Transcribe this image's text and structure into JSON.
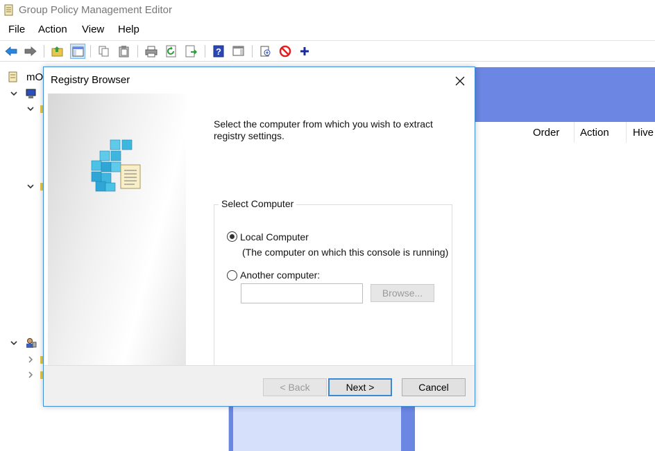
{
  "window": {
    "title": "Group Policy Management Editor"
  },
  "menu": [
    {
      "label": "File"
    },
    {
      "label": "Action"
    },
    {
      "label": "View"
    },
    {
      "label": "Help"
    }
  ],
  "toolbar": {
    "icons": [
      "back-arrow-icon",
      "forward-arrow-icon",
      "up-folder-icon",
      "show-hide-tree-icon",
      "copy-icon",
      "paste-icon",
      "print-icon",
      "refresh-icon",
      "export-list-icon",
      "help-icon",
      "show-hide-action-pane-icon",
      "new-item-icon",
      "delete-icon",
      "add-icon"
    ]
  },
  "tree": {
    "root_label": "mO"
  },
  "columns": [
    {
      "label": "Order"
    },
    {
      "label": "Action"
    },
    {
      "label": "Hive"
    }
  ],
  "dialog": {
    "title": "Registry Browser",
    "intro": "Select the computer from which you wish to extract registry settings.",
    "group_label": "Select Computer",
    "local_label": "Local Computer",
    "local_note": "(The computer on which this console is running)",
    "local_selected": true,
    "another_label": "Another computer:",
    "another_value": "",
    "browse_label": "Browse...",
    "back_label": "< Back",
    "next_label": "Next >",
    "cancel_label": "Cancel"
  },
  "colors": {
    "accent_band": "#6b86e3",
    "dialog_border": "#3d8fd9"
  }
}
